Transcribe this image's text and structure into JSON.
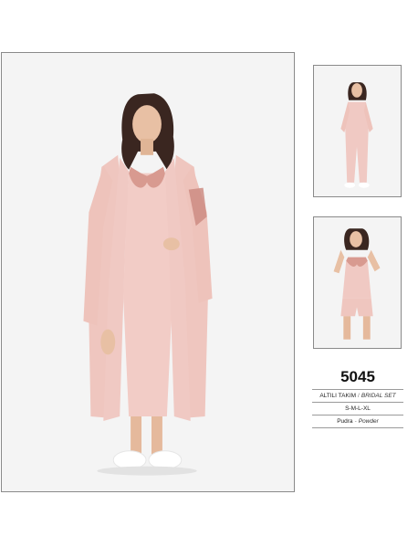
{
  "product": {
    "code": "5045",
    "set_name": "ALTILI TAKIM",
    "set_separator": "/",
    "set_name_en": "BRIDAL SET",
    "sizes": "S-M-L-XL",
    "color_name": "Pudra",
    "color_separator": "-",
    "color_name_en": "Powder"
  },
  "palette": {
    "garment": "#f0c9c3",
    "garment_shadow": "#dca79f",
    "lace": "#c98a82",
    "skin": "#e8c0a4",
    "hair": "#3a2620",
    "background": "#f4f4f4",
    "border": "#8a8a8a"
  }
}
